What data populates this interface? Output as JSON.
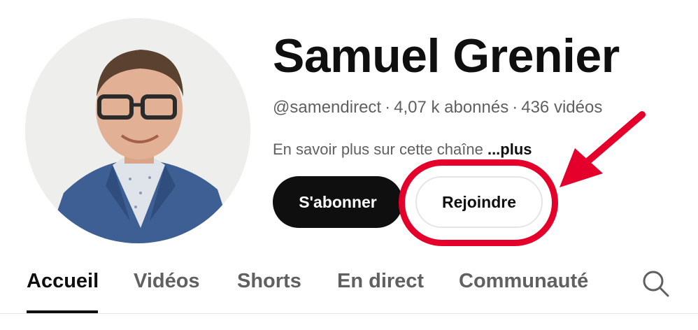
{
  "channel": {
    "name": "Samuel Grenier",
    "handle": "@samendirect",
    "separator": "·",
    "subscribers": "4,07 k abonnés",
    "videos": "436 vidéos",
    "about": "En savoir plus sur cette chaîne",
    "about_more": "...plus"
  },
  "buttons": {
    "subscribe": "S'abonner",
    "join": "Rejoindre"
  },
  "tabs": [
    {
      "label": "Accueil",
      "active": true
    },
    {
      "label": "Vidéos",
      "active": false
    },
    {
      "label": "Shorts",
      "active": false
    },
    {
      "label": "En direct",
      "active": false
    },
    {
      "label": "Communauté",
      "active": false
    }
  ],
  "icons": {
    "search": "search-icon",
    "arrow": "arrow-icon"
  },
  "colors": {
    "highlight": "#e4002b",
    "primary_text": "#0f0f0f",
    "secondary_text": "#606060",
    "subscribe_bg": "#0f0f0f"
  }
}
